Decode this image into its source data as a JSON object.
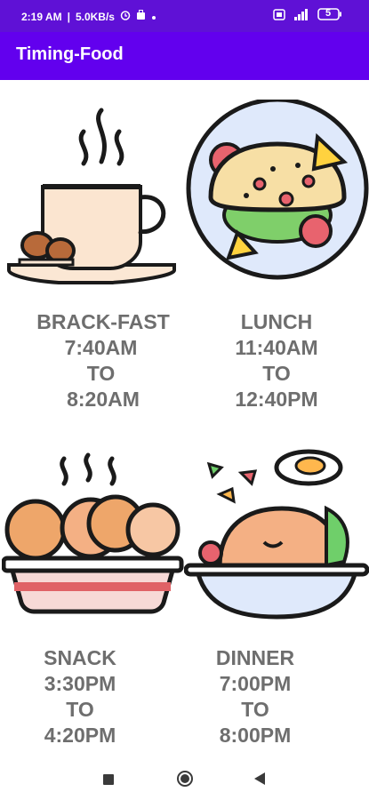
{
  "status_bar": {
    "time": "2:19 AM",
    "speed": "5.0KB/s",
    "battery": "5"
  },
  "app_bar": {
    "title": "Timing-Food"
  },
  "meals": [
    {
      "name": "BRACK-FAST",
      "start": "7:40AM",
      "to": "TO",
      "end": "8:20AM",
      "icon": "coffee-cup-icon"
    },
    {
      "name": "LUNCH",
      "start": "11:40AM",
      "to": "TO",
      "end": "12:40PM",
      "icon": "taco-plate-icon"
    },
    {
      "name": "SNACK",
      "start": "3:30PM",
      "to": "TO",
      "end": "4:20PM",
      "icon": "cookies-bowl-icon"
    },
    {
      "name": "DINNER",
      "start": "7:00PM",
      "to": "TO",
      "end": "8:00PM",
      "icon": "rice-bowl-icon"
    }
  ],
  "nav": {
    "back_icon": "back-triangle-icon",
    "home_icon": "home-circle-icon",
    "recents_icon": "recents-square-icon"
  }
}
